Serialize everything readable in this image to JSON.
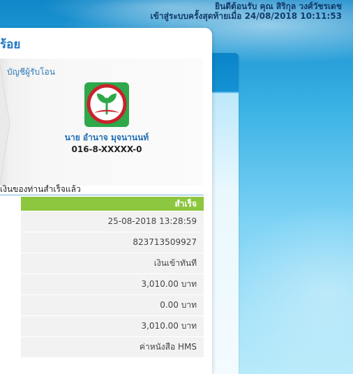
{
  "header": {
    "welcome": "ยินดีต้อนรับ คุณ สิริกุล วงศ์วัชรเดช",
    "last_login": "เข้าสู่ระบบครั้งสุดท้ายเมื่อ 24/08/2018 10:11:53"
  },
  "card": {
    "title": "ร้อย",
    "recipient": {
      "label": "บัญชีผู้รับโอน",
      "bank_icon": "kbank-logo-icon",
      "name": "นาย อำนาจ มุจนานนท์",
      "account": "016-8-XXXXX-0"
    },
    "status_heading": "เงินของท่านสำเร็จแล้ว",
    "status": "สำเร็จ",
    "details": [
      "25-08-2018 13:28:59",
      "823713509927",
      "เงินเข้าทันที",
      "3,010.00 บาท",
      "0.00 บาท",
      "3,010.00 บาท",
      "ค่าหนังสือ HMS"
    ]
  },
  "colors": {
    "accent_blue": "#1f76c1",
    "success_green": "#8dc63f",
    "bank_green": "#2ea84a"
  }
}
